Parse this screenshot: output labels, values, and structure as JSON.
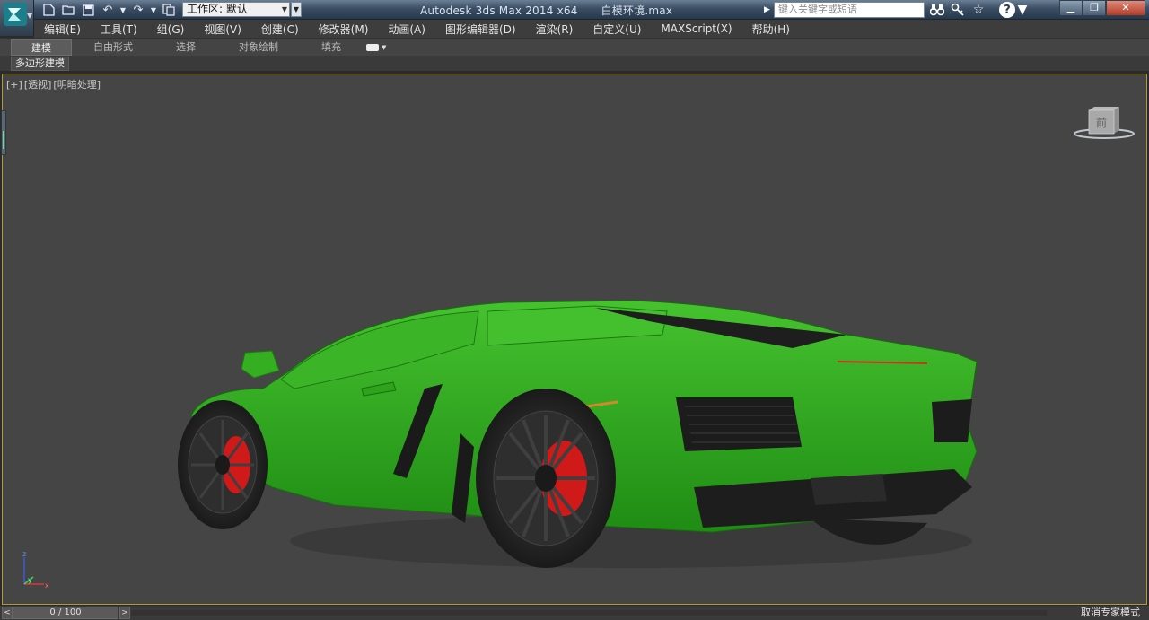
{
  "titlebar": {
    "app_name": "Autodesk 3ds Max  2014 x64",
    "file_name": "白模环境.max",
    "workspace_label": "工作区: 默认",
    "search_placeholder": "键入关键字或短语"
  },
  "menu": [
    "编辑(E)",
    "工具(T)",
    "组(G)",
    "视图(V)",
    "创建(C)",
    "修改器(M)",
    "动画(A)",
    "图形编辑器(D)",
    "渲染(R)",
    "自定义(U)",
    "MAXScript(X)",
    "帮助(H)"
  ],
  "ribbon": {
    "tabs": [
      "建模",
      "自由形式",
      "选择",
      "对象绘制",
      "填充"
    ],
    "active_tab": "建模",
    "panel_label": "多边形建模"
  },
  "viewport": {
    "label_plus": "[+]",
    "label_view": "[透视]",
    "label_shading": "[明暗处理]",
    "viewcube_face": "前",
    "axis_z": "z",
    "axis_y": "y",
    "axis_x": "x",
    "car_color": "#2fa81f",
    "brake_color": "#d01a1a"
  },
  "status": {
    "timeline_value": "0 / 100",
    "expert_mode": "取消专家模式",
    "timeline_left": "<",
    "timeline_right": ">"
  },
  "colors": {
    "viewport_bg": "#454545",
    "viewport_border": "#b49a36",
    "titlebar": "#3b4e63"
  },
  "icons": [
    "app-logo-icon",
    "new-file-icon",
    "open-folder-icon",
    "save-icon",
    "undo-icon",
    "redo-icon",
    "project-folder-icon",
    "binoculars-icon",
    "key-icon",
    "star-icon",
    "help-icon"
  ]
}
